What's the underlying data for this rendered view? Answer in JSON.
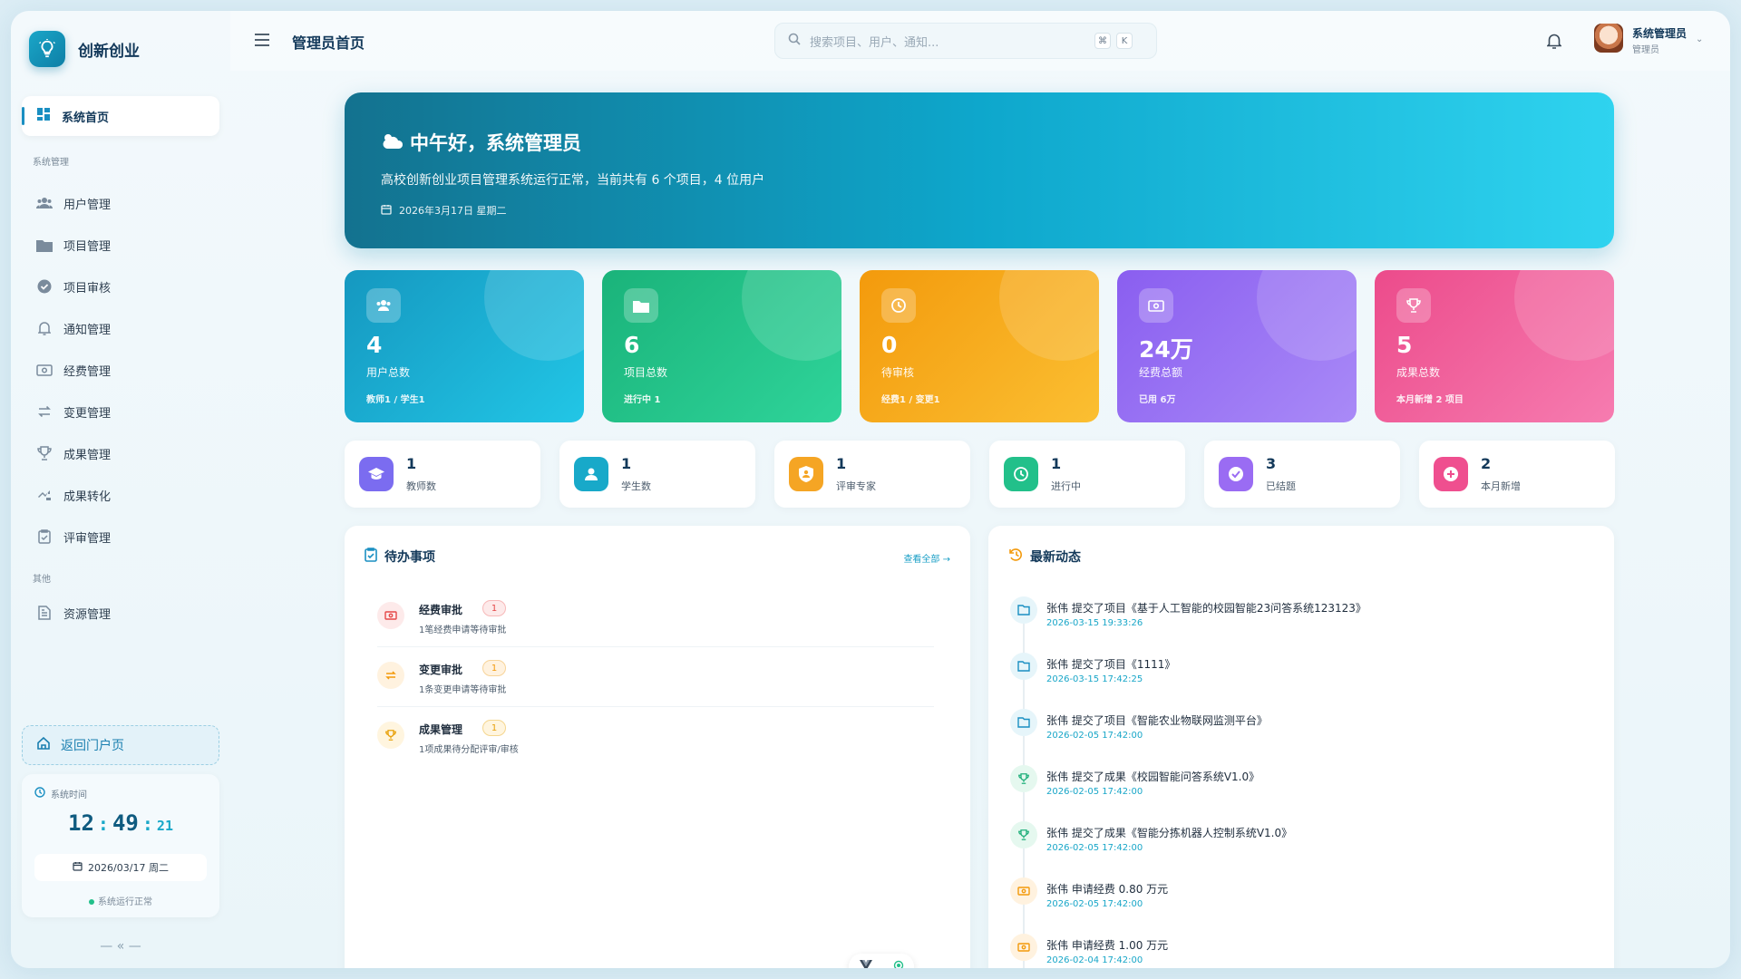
{
  "app": {
    "name": "创新创业",
    "page_title": "管理员首页"
  },
  "sidebar": {
    "home": "系统首页",
    "section_system": "系统管理",
    "items": [
      {
        "label": "用户管理",
        "icon": "users-icon"
      },
      {
        "label": "项目管理",
        "icon": "folder-icon"
      },
      {
        "label": "项目审核",
        "icon": "check-badge-icon"
      },
      {
        "label": "通知管理",
        "icon": "bell-icon"
      },
      {
        "label": "经费管理",
        "icon": "money-icon"
      },
      {
        "label": "变更管理",
        "icon": "swap-icon"
      },
      {
        "label": "成果管理",
        "icon": "trophy-icon"
      },
      {
        "label": "成果转化",
        "icon": "transfer-icon"
      },
      {
        "label": "评审管理",
        "icon": "clipboard-check-icon"
      }
    ],
    "section_other": "其他",
    "other_items": [
      {
        "label": "资源管理",
        "icon": "document-icon"
      }
    ],
    "back_portal": "返回门户页",
    "clock": {
      "label": "系统时间",
      "hh": "12",
      "mm": "49",
      "ss": "21",
      "date": "2026/03/17 周二",
      "status": "系统运行正常"
    },
    "collapse": "— « —"
  },
  "header": {
    "search_placeholder": "搜索项目、用户、通知...",
    "kbd1": "⌘",
    "kbd2": "K",
    "user_name": "系统管理员",
    "user_role": "管理员"
  },
  "hero": {
    "title": "中午好，系统管理员",
    "subtitle": "高校创新创业项目管理系统运行正常，当前共有 6 个项目，4 位用户",
    "date": "2026年3月17日 星期二"
  },
  "stats": [
    {
      "value": "4",
      "label": "用户总数",
      "note": "教师1 / 学生1",
      "icon": "users-icon"
    },
    {
      "value": "6",
      "label": "项目总数",
      "note": "进行中 1",
      "icon": "folder-icon"
    },
    {
      "value": "0",
      "label": "待审核",
      "note": "经费1 / 变更1",
      "icon": "clock-icon"
    },
    {
      "value": "24万",
      "label": "经费总额",
      "note": "已用 6万",
      "icon": "money-icon"
    },
    {
      "value": "5",
      "label": "成果总数",
      "note": "本月新增 2 项目",
      "icon": "trophy-icon"
    }
  ],
  "mini": [
    {
      "value": "1",
      "label": "教师数",
      "icon": "graduation-cap-icon",
      "color": "#7b6cf0"
    },
    {
      "value": "1",
      "label": "学生数",
      "icon": "student-icon",
      "color": "#18a9c9"
    },
    {
      "value": "1",
      "label": "评审专家",
      "icon": "shield-user-icon",
      "color": "#f5a524"
    },
    {
      "value": "1",
      "label": "进行中",
      "icon": "clock-icon",
      "color": "#22c08a"
    },
    {
      "value": "3",
      "label": "已结题",
      "icon": "check-circle-icon",
      "color": "#9a6cf3"
    },
    {
      "value": "2",
      "label": "本月新增",
      "icon": "plus-circle-icon",
      "color": "#ef4f8f"
    }
  ],
  "todo": {
    "title": "待办事项",
    "view_all": "查看全部 →",
    "items": [
      {
        "title": "经费审批",
        "count": "1",
        "sub": "1笔经费申请等待审批"
      },
      {
        "title": "变更审批",
        "count": "1",
        "sub": "1条变更申请等待审批"
      },
      {
        "title": "成果管理",
        "count": "1",
        "sub": "1项成果待分配评审/审核"
      }
    ]
  },
  "activity": {
    "title": "最新动态",
    "items": [
      {
        "text": "张伟 提交了项目《基于人工智能的校园智能23问答系统123123》",
        "time": "2026-03-15 19:33:26"
      },
      {
        "text": "张伟 提交了项目《1111》",
        "time": "2026-03-15 17:42:25"
      },
      {
        "text": "张伟 提交了项目《智能农业物联网监测平台》",
        "time": "2026-02-05 17:42:00"
      },
      {
        "text": "张伟 提交了成果《校园智能问答系统V1.0》",
        "time": "2026-02-05 17:42:00"
      },
      {
        "text": "张伟 提交了成果《智能分拣机器人控制系统V1.0》",
        "time": "2026-02-05 17:42:00"
      },
      {
        "text": "张伟 申请经费 0.80 万元",
        "time": "2026-02-05 17:42:00"
      },
      {
        "text": "张伟 申请经费 1.00 万元",
        "time": "2026-02-04 17:42:00"
      }
    ]
  }
}
